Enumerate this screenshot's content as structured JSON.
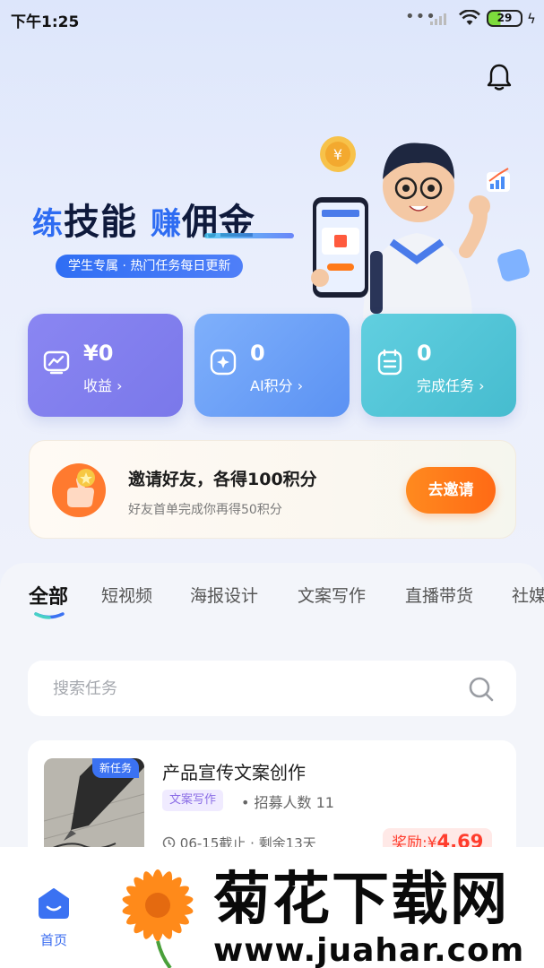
{
  "status_bar": {
    "time": "下午1:25",
    "battery": "29"
  },
  "hero": {
    "title_part1": "练",
    "title_part2": "技能",
    "title_part3": "赚",
    "title_part4": "佣金",
    "subtitle": "学生专属 · 热门任务每日更新"
  },
  "stats": [
    {
      "value": "¥0",
      "label": "收益 ›",
      "icon": "chart-icon"
    },
    {
      "value": "0",
      "label": "AI积分 ›",
      "icon": "ai-points-icon"
    },
    {
      "value": "0",
      "label": "完成任务 ›",
      "icon": "task-list-icon"
    }
  ],
  "invite": {
    "title": "邀请好友，各得100积分",
    "subtitle": "好友首单完成你再得50积分",
    "button": "去邀请"
  },
  "tabs": [
    {
      "label": "全部",
      "active": true
    },
    {
      "label": "短视频"
    },
    {
      "label": "海报设计"
    },
    {
      "label": "文案写作"
    },
    {
      "label": "直播带货"
    },
    {
      "label": "社媒"
    }
  ],
  "search": {
    "placeholder": "搜索任务"
  },
  "tasks": [
    {
      "tag": "新任务",
      "title": "产品宣传文案创作",
      "category": "文案写作",
      "recruit": "• 招募人数 11",
      "deadline": "06-15截止 · 剩余13天",
      "reward_prefix": "奖励:¥",
      "reward_value": "4.69"
    }
  ],
  "bottom_nav": {
    "home_label": "首页"
  },
  "watermark": {
    "text": "菊花下载网",
    "url": "www.juahar.com"
  },
  "colors": {
    "accent": "#3b72f2",
    "orange": "#ff7a1a",
    "reward_red": "#ff3d2d"
  }
}
